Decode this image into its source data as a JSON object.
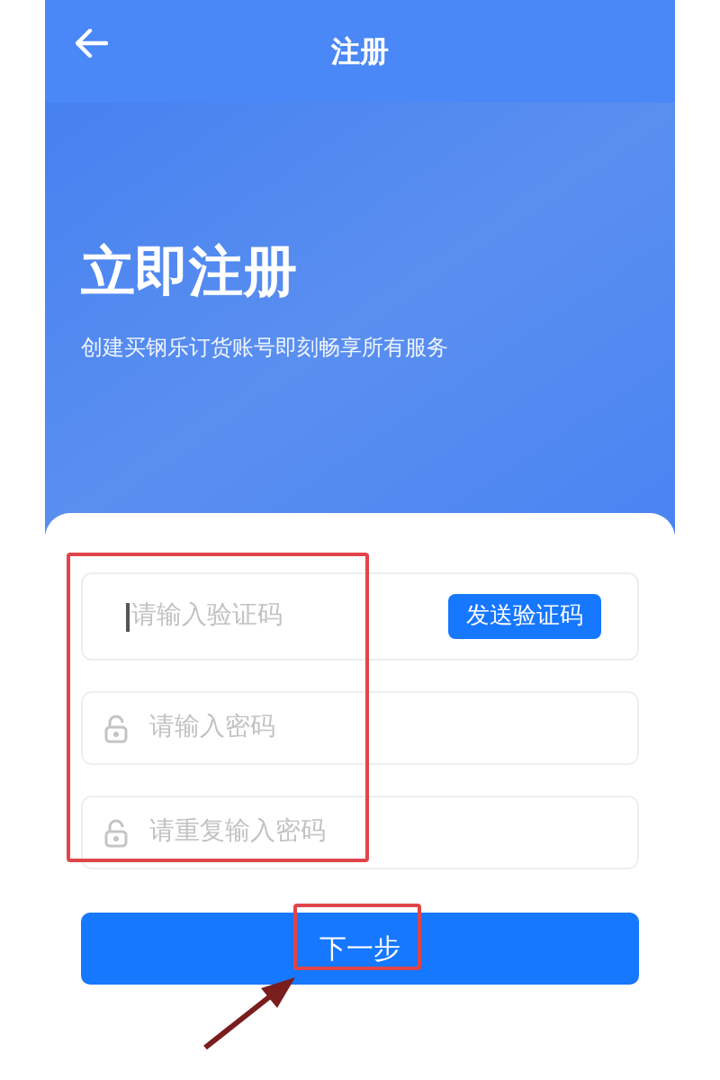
{
  "header": {
    "title": "注册"
  },
  "hero": {
    "title": "立即注册",
    "subtitle": "创建买钢乐订货账号即刻畅享所有服务"
  },
  "fields": [
    {
      "kind": "code",
      "placeholder": "请输入验证码",
      "action": "发送验证码"
    },
    {
      "kind": "password",
      "placeholder": "请输入密码"
    },
    {
      "kind": "password",
      "placeholder": "请重复输入密码"
    }
  ],
  "next_button": {
    "label": "下一步"
  }
}
